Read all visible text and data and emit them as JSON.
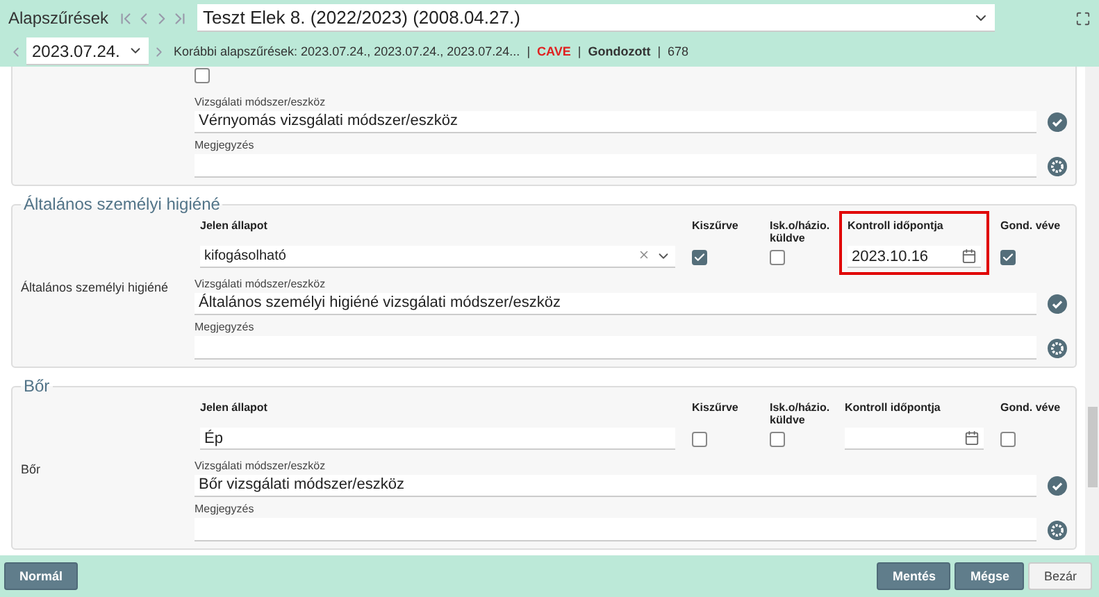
{
  "header": {
    "title": "Alapszűrések",
    "patient": "Teszt Elek 8. (2022/2023) (2008.04.27.)",
    "date": "2023.07.24.",
    "previous": "Korábbi alapszűrések: 2023.07.24., 2023.07.24., 2023.07.24...",
    "separator": "|",
    "tags": [
      {
        "text": "CAVE",
        "kind": "alert"
      },
      {
        "text": "Gondozott",
        "kind": "bold"
      },
      {
        "text": "678",
        "kind": "plain"
      }
    ]
  },
  "sections": [
    {
      "kind": "partial",
      "checkbox": {
        "checked": false
      },
      "method": {
        "label": "Vizsgálati módszer/eszköz",
        "value": "Vérnyomás vizsgálati módszer/eszköz"
      },
      "note": {
        "label": "Megjegyzés"
      }
    },
    {
      "kind": "full",
      "title": "Általános személyi higiéné",
      "row_label": "Általános személyi higiéné",
      "columns": [
        "Jelen állapot",
        "Kiszűrve",
        "Isk.o/házio. küldve",
        "Kontroll időpontja",
        "Gond. véve"
      ],
      "state": {
        "kind": "select",
        "value": "kifogásolható"
      },
      "screened": {
        "checked": true
      },
      "sent": {
        "checked": false
      },
      "control_date": {
        "value": "2023.10.16",
        "highlighted": true
      },
      "cared": {
        "checked": true
      },
      "method": {
        "label": "Vizsgálati módszer/eszköz",
        "value": "Általános személyi higiéné vizsgálati módszer/eszköz"
      },
      "note": {
        "label": "Megjegyzés"
      }
    },
    {
      "kind": "full",
      "title": "Bőr",
      "row_label": "Bőr",
      "columns": [
        "Jelen állapot",
        "Kiszűrve",
        "Isk.o/házio. küldve",
        "Kontroll időpontja",
        "Gond. véve"
      ],
      "state": {
        "kind": "text",
        "value": "Ép"
      },
      "screened": {
        "checked": false
      },
      "sent": {
        "checked": false
      },
      "control_date": {
        "highlighted": false
      },
      "cared": {
        "checked": false
      },
      "method": {
        "label": "Vizsgálati módszer/eszköz",
        "value": "Bőr vizsgálati módszer/eszköz"
      },
      "note": {
        "label": "Megjegyzés"
      }
    }
  ],
  "footer": {
    "left": "Normál",
    "buttons": [
      {
        "label": "Mentés",
        "kind": "primary"
      },
      {
        "label": "Mégse",
        "kind": "primary"
      },
      {
        "label": "Bezár",
        "kind": "plain"
      }
    ]
  }
}
